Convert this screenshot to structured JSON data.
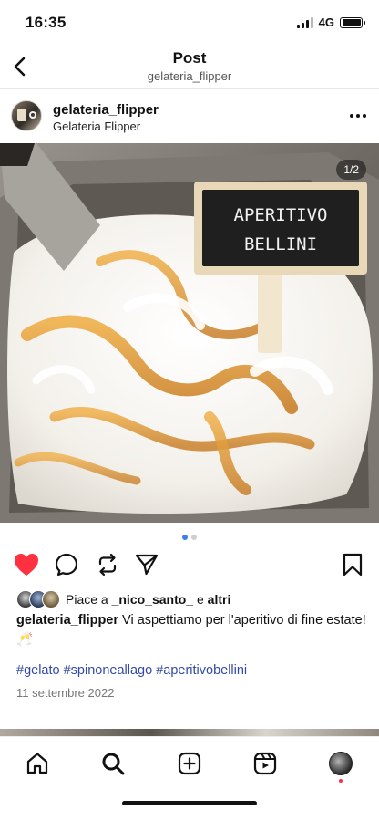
{
  "status_bar": {
    "time": "16:35",
    "network": "4G"
  },
  "header": {
    "title": "Post",
    "subtitle": "gelateria_flipper"
  },
  "post": {
    "username": "gelateria_flipper",
    "location": "Gelateria Flipper",
    "image_counter": "1/2",
    "image_sign": {
      "line1": "APERITIVO",
      "line2": "BELLINI"
    },
    "carousel": {
      "total": 2,
      "active": 1
    },
    "liked": true,
    "likes": {
      "prefix": "Piace a",
      "user": "_nico_santo_",
      "joiner": "e",
      "others": "altri"
    },
    "caption": {
      "username": "gelateria_flipper",
      "text": "Vi aspettiamo per l'aperitivo di fine estate! 🥂"
    },
    "hashtags": [
      "#gelato",
      "#spinoneallago",
      "#aperitivobellini"
    ],
    "date": "11 settembre 2022"
  },
  "icons": {
    "back": "chevron-left-icon",
    "more": "more-horizontal-icon",
    "like": "heart-icon",
    "comment": "comment-icon",
    "repost": "repost-icon",
    "share": "send-icon",
    "save": "bookmark-icon",
    "nav": [
      "home-icon",
      "search-icon",
      "create-icon",
      "reels-icon",
      "profile-avatar"
    ]
  },
  "colors": {
    "like": "#ff3040",
    "hashtag": "#324aa8",
    "carousel_active": "#3f7de8",
    "notification": "#ff2d48"
  }
}
